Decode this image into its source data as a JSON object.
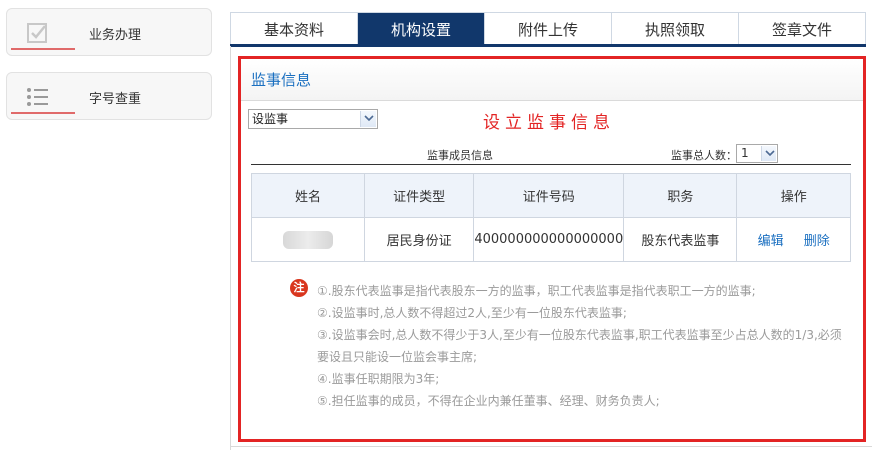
{
  "sidebar": {
    "items": [
      {
        "label": "业务办理",
        "icon": "check-icon"
      },
      {
        "label": "字号查重",
        "icon": "list-icon"
      }
    ]
  },
  "tabs": [
    {
      "label": "基本资料",
      "active": false
    },
    {
      "label": "机构设置",
      "active": true
    },
    {
      "label": "附件上传",
      "active": false
    },
    {
      "label": "执照领取",
      "active": false
    },
    {
      "label": "签章文件",
      "active": false
    }
  ],
  "panel": {
    "title": "监事信息",
    "select_value": "设监事",
    "heading": "设立监事信息",
    "members_label": "监事成员信息",
    "total_label": "监事总人数：",
    "total_value": "1"
  },
  "table": {
    "headers": [
      "姓名",
      "证件类型",
      "证件号码",
      "职务",
      "操作"
    ],
    "rows": [
      {
        "id_type": "居民身份证",
        "id_number": "400000000000000000",
        "position": "股东代表监事",
        "edit": "编辑",
        "delete": "删除"
      }
    ]
  },
  "notes": {
    "badge": "注",
    "lines": [
      "①.股东代表监事是指代表股东一方的监事，职工代表监事是指代表职工一方的监事;",
      "②.设监事时,总人数不得超过2人,至少有一位股东代表监事;",
      "③.设监事会时,总人数不得少于3人,至少有一位股东代表监事,职工代表监事至少占总人数的1/3,必须要设且只能设一位监会事主席;",
      "④.监事任职期限为3年;",
      "⑤.担任监事的成员，不得在企业内兼任董事、经理、财务负责人;"
    ]
  },
  "colors": {
    "tab_active": "#11376b",
    "highlight_border": "#e32424",
    "title_blue": "#1a6fc0",
    "note_badge": "#d9361e"
  }
}
